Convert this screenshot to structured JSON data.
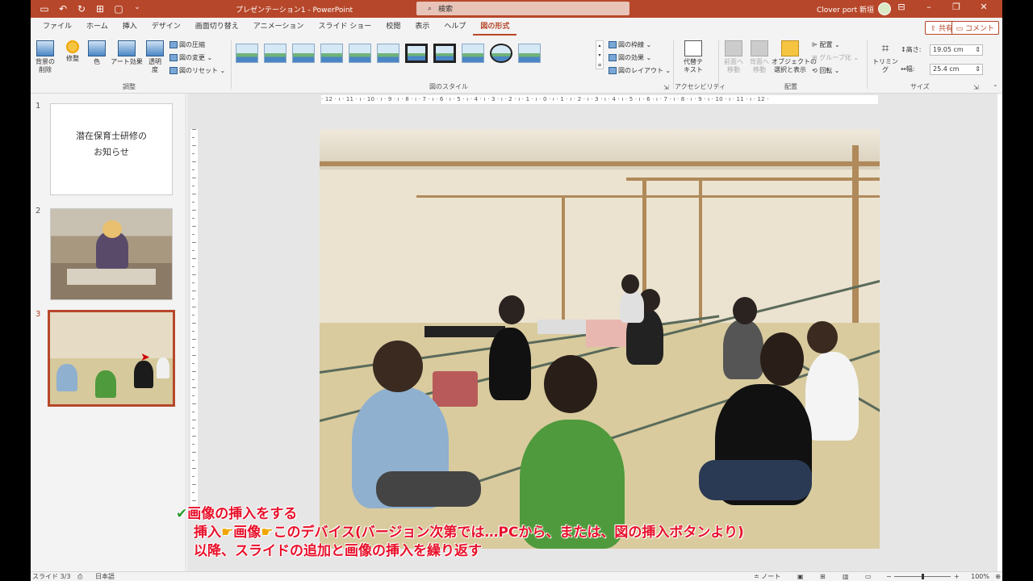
{
  "titlebar": {
    "doc_title": "プレゼンテーション1  -  PowerPoint",
    "search_placeholder": "検索",
    "user_name": "Clover port 新垣",
    "qat_icons": [
      "save-icon",
      "undo-icon",
      "redo-icon",
      "present-icon",
      "new-icon"
    ]
  },
  "tabs": [
    {
      "label": "ファイル"
    },
    {
      "label": "ホーム"
    },
    {
      "label": "挿入"
    },
    {
      "label": "デザイン"
    },
    {
      "label": "画面切り替え"
    },
    {
      "label": "アニメーション"
    },
    {
      "label": "スライド ショー"
    },
    {
      "label": "校閲"
    },
    {
      "label": "表示"
    },
    {
      "label": "ヘルプ"
    },
    {
      "label": "図の形式",
      "active": true
    }
  ],
  "share_label": "共有",
  "comment_label": "コメント",
  "ribbon": {
    "adjust": {
      "remove_bg": "背景の\n削除",
      "corrections": "修整",
      "color": "色",
      "artistic": "アート効果",
      "transparency": "透明\n度",
      "compress": "図の圧縮",
      "change": "図の変更",
      "reset": "図のリセット",
      "group_label": "調整"
    },
    "styles": {
      "border": "図の枠線",
      "effects": "図の効果",
      "layout": "図のレイアウト",
      "group_label": "図のスタイル"
    },
    "accessibility": {
      "alt_text": "代替テ\nキスト",
      "group_label": "アクセシビリティ"
    },
    "arrange": {
      "bring_forward": "前面へ\n移動",
      "send_backward": "背面へ\n移動",
      "selection_pane": "オブジェクトの\n選択と表示",
      "align": "配置",
      "group": "グループ化",
      "rotate": "回転",
      "group_label": "配置"
    },
    "size": {
      "crop": "トリミング",
      "height_label": "高さ:",
      "height_value": "19.05 cm",
      "width_label": "幅:",
      "width_value": "25.4 cm",
      "group_label": "サイズ"
    }
  },
  "slides": [
    {
      "num": "1",
      "text_line1": "潜在保育士研修の",
      "text_line2": "お知らせ"
    },
    {
      "num": "2"
    },
    {
      "num": "3",
      "selected": true
    }
  ],
  "ruler": {
    "horizontal": "· 12 · ı · 11 · ı · 10 · ı · 9 · ı · 8 · ı · 7 · ı · 6 · ı · 5 · ı · 4 · ı · 3 · ı · 2 · ı · 1 · ı · 0 · ı · 1 · ı · 2 · ı · 3 · ı · 4 · ı · 5 · ı · 6 · ı · 7 · ı · 8 · ı · 9 · ı · 10 · ı · 11 · ı · 12 ·"
  },
  "caption": {
    "line1_check": "✔",
    "line1": "画像の挿入をする",
    "line2_a": "挿入",
    "line2_b": "画像",
    "line2_c": "このデバイス(バージョン次第では…PCから、または、図の挿入ボタンより)",
    "hand_icon": "☛",
    "line3": "以降、スライドの追加と画像の挿入を繰り返す"
  },
  "statusbar": {
    "slide_info": "スライド 3/3",
    "language": "日本語",
    "notes": "ノート",
    "zoom": "100%"
  },
  "colors": {
    "accent": "#b7472a",
    "caption_red": "#e8102a",
    "check_green": "#2b9a2b"
  }
}
